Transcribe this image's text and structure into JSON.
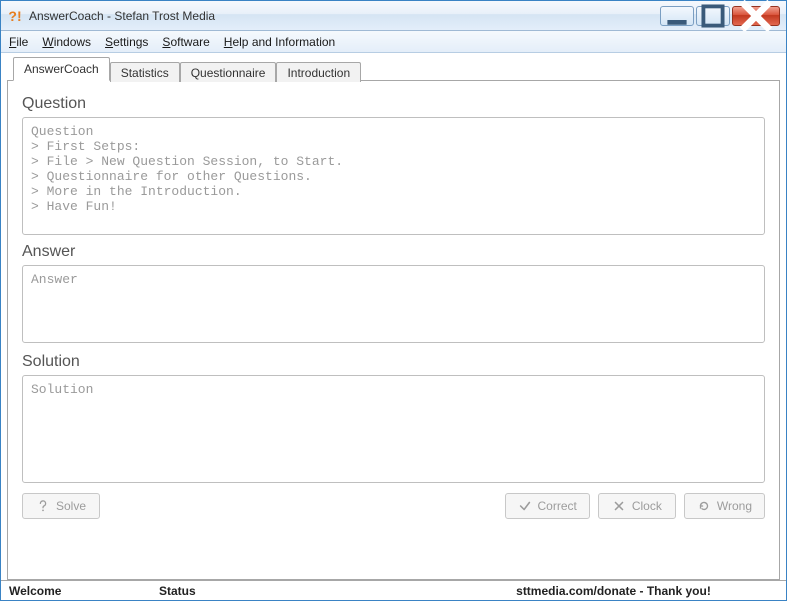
{
  "window": {
    "title": "AnswerCoach - Stefan Trost Media"
  },
  "menu": {
    "file": "File",
    "windows": "Windows",
    "settings": "Settings",
    "software": "Software",
    "help": "Help and Information"
  },
  "tabs": {
    "answercoach": "AnswerCoach",
    "statistics": "Statistics",
    "questionnaire": "Questionnaire",
    "introduction": "Introduction"
  },
  "labels": {
    "question": "Question",
    "answer": "Answer",
    "solution": "Solution"
  },
  "fields": {
    "question_text": "Question\n> First Setps:\n> File > New Question Session, to Start.\n> Questionnaire for other Questions.\n> More in the Introduction.\n> Have Fun!",
    "answer_placeholder": "Answer",
    "solution_placeholder": "Solution"
  },
  "buttons": {
    "solve": "Solve",
    "correct": "Correct",
    "clock": "Clock",
    "wrong": "Wrong"
  },
  "status": {
    "welcome": "Welcome",
    "status": "Status",
    "donate": "sttmedia.com/donate - Thank you!"
  }
}
